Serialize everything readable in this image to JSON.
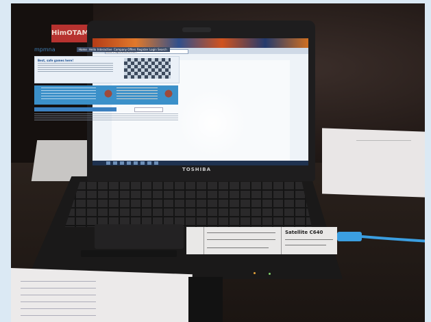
{
  "scene": {
    "sign_text": "HimOTAMe",
    "laptop_brand": "TOSHIBA",
    "sticker_model": "Satellite C640"
  },
  "screen": {
    "site_logo": "mpmna",
    "nav_items": [
      "Home",
      "Hello",
      "Interactive",
      "Company Offers",
      "Register",
      "Login",
      "Search"
    ],
    "hero_title": "Best, safe games here!",
    "address": "www.maplewoods.com"
  },
  "colors": {
    "cable": "#3b9ee0",
    "led_amber": "#e2a13a",
    "led_green": "#7fd36a"
  }
}
